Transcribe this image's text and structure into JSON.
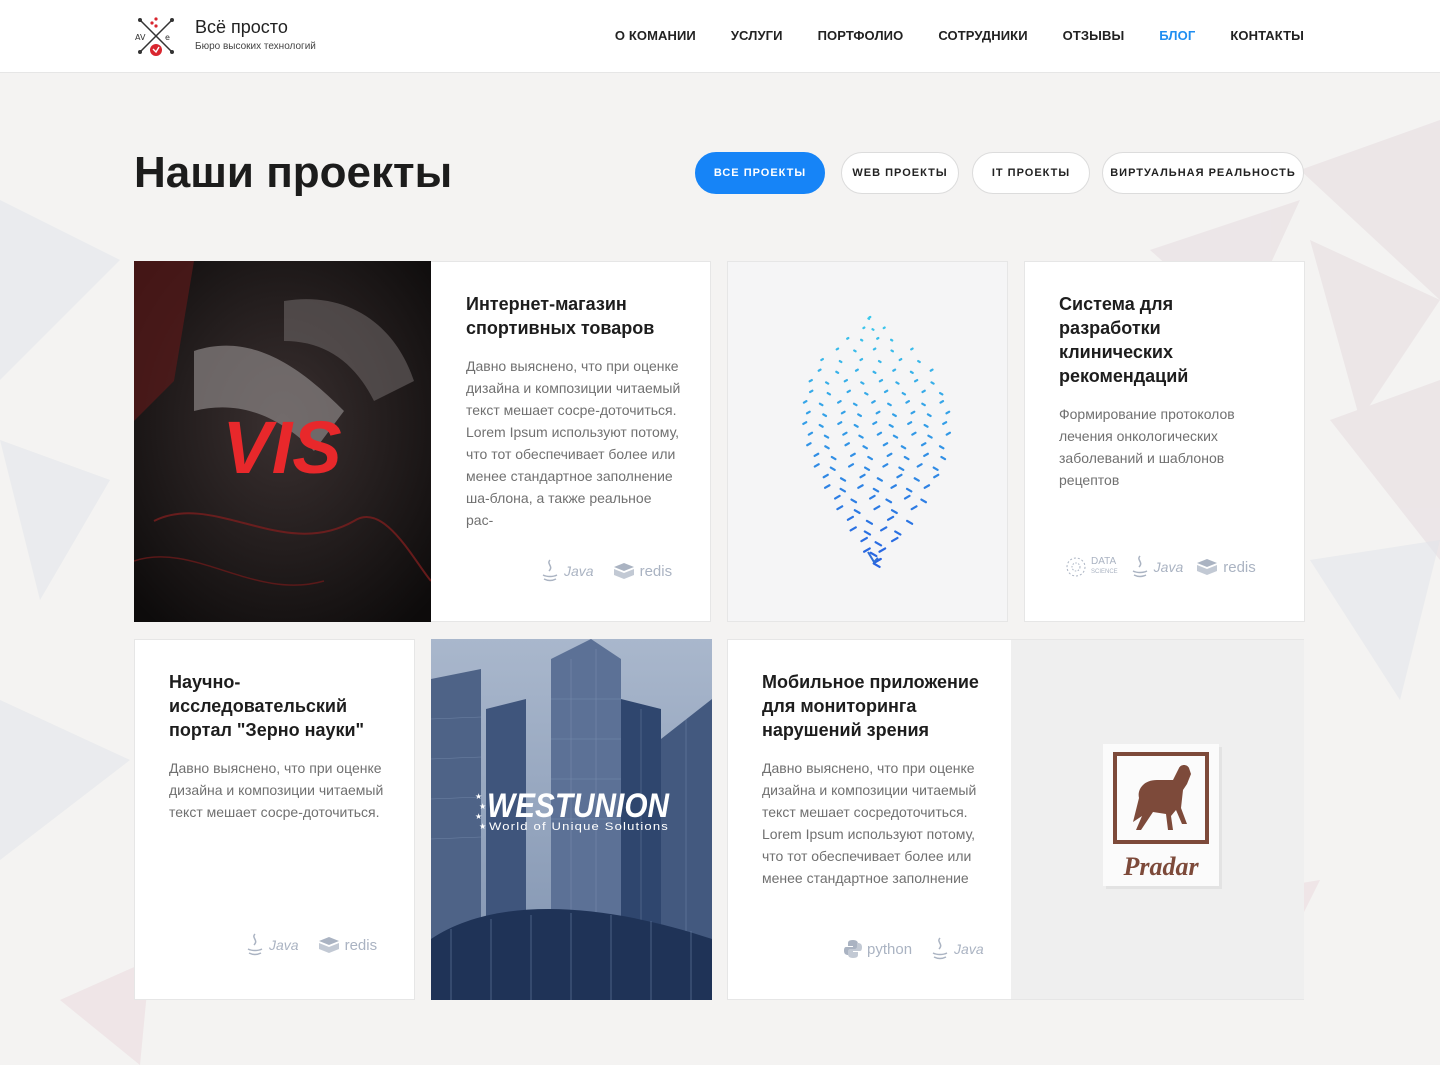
{
  "header": {
    "brand_title": "Всё просто",
    "brand_subtitle": "Бюро высоких технологий",
    "nav": [
      {
        "label": "О КОМАНИИ",
        "active": false
      },
      {
        "label": "УСЛУГИ",
        "active": false
      },
      {
        "label": "ПОРТФОЛИО",
        "active": false
      },
      {
        "label": "СОТРУДНИКИ",
        "active": false
      },
      {
        "label": "ОТЗЫВЫ",
        "active": false
      },
      {
        "label": "БЛОГ",
        "active": true
      },
      {
        "label": "КОНТАКТЫ",
        "active": false
      }
    ]
  },
  "main": {
    "title": "Наши проекты",
    "filters": [
      {
        "label": "ВСЕ ПРОЕКТЫ",
        "active": true
      },
      {
        "label": "WEB ПРОЕКТЫ",
        "active": false
      },
      {
        "label": "IT ПРОЕКТЫ",
        "active": false
      },
      {
        "label": "ВИРТУАЛЬНАЯ РЕАЛЬНОСТЬ",
        "active": false
      }
    ],
    "projects": [
      {
        "title": "Интернет-магазин спортивных товаров",
        "text": "Давно выяснено, что при оценке дизайна и композиции читаемый текст мешает сосре-доточиться. Lorem Ipsum используют потому, что тот обеспечивает более или менее стандартное заполнение ша-блона, а также реальное рас-",
        "tech": [
          "Java",
          "redis"
        ],
        "image_logo": "VIS"
      },
      {
        "title": "Система для разработки клинических рекомендаций",
        "text": "Формирование протоколов лечения онкологических заболеваний и шаблонов рецептов",
        "tech": [
          "DATA",
          "SCIENCE",
          "Java",
          "redis"
        ]
      },
      {
        "title": "Научно-исследовательский портал \"Зерно науки\"",
        "text": "Давно выяснено, что при оценке дизайна и композиции читаемый текст мешает сосре-доточиться.",
        "tech": [
          "Java",
          "redis"
        ]
      },
      {
        "title": "Мобильное приложение для мониторинга нарушений зрения",
        "text": "Давно выяснено, что при оценке дизайна и композиции читаемый текст мешает сосредоточиться. Lorem Ipsum используют потому, что тот обеспечивает более или менее стандартное заполнение",
        "tech": [
          "python",
          "Java"
        ]
      }
    ],
    "tiles": {
      "westunion_name": "WESTUNION",
      "westunion_tagline": "World of Unique Solutions",
      "pradar_name": "Pradar"
    }
  },
  "colors": {
    "accent": "#1684f7",
    "nav_active": "#1f8ef1",
    "vis_red": "#e8282b",
    "brown": "#7d4a3a"
  },
  "icons": [
    "logo-mark",
    "java-icon",
    "redis-icon",
    "data-science-icon",
    "python-icon",
    "leaf-mesh-graphic",
    "horse-icon"
  ]
}
